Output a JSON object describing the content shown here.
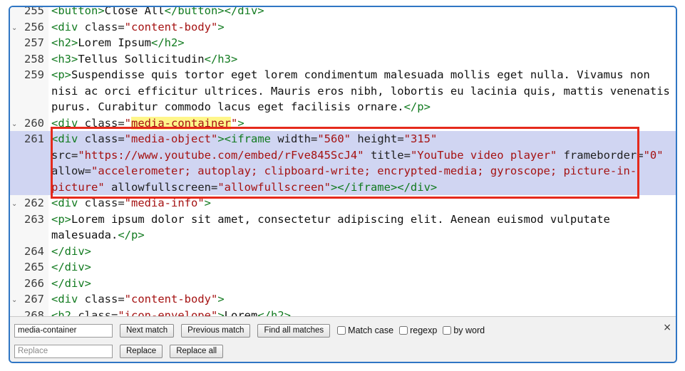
{
  "editor": {
    "lines": [
      {
        "num": "255",
        "fold": false,
        "segments": [
          {
            "c": "tag",
            "t": "<button>"
          },
          {
            "c": "text",
            "t": "Close All"
          },
          {
            "c": "tag",
            "t": "</button></div>"
          }
        ]
      },
      {
        "num": "256",
        "fold": true,
        "segments": [
          {
            "c": "tag",
            "t": "<div "
          },
          {
            "c": "attr",
            "t": "class="
          },
          {
            "c": "str",
            "t": "\"content-body\""
          },
          {
            "c": "tag",
            "t": ">"
          }
        ]
      },
      {
        "num": "257",
        "fold": false,
        "segments": [
          {
            "c": "tag",
            "t": "<h2>"
          },
          {
            "c": "text",
            "t": "Lorem Ipsum"
          },
          {
            "c": "tag",
            "t": "</h2>"
          }
        ]
      },
      {
        "num": "258",
        "fold": false,
        "segments": [
          {
            "c": "tag",
            "t": "<h3>"
          },
          {
            "c": "text",
            "t": "Tellus Sollicitudin"
          },
          {
            "c": "tag",
            "t": "</h3>"
          }
        ]
      },
      {
        "num": "259",
        "fold": false,
        "segments": [
          {
            "c": "tag",
            "t": "<p>"
          },
          {
            "c": "text",
            "t": "Suspendisse quis tortor eget lorem condimentum malesuada mollis eget nulla. Vivamus non nisi ac orci efficitur ultrices. Mauris eros nibh, lobortis eu lacinia quis, mattis venenatis purus. Curabitur commodo lacus eget facilisis ornare."
          },
          {
            "c": "tag",
            "t": "</p>"
          }
        ]
      },
      {
        "num": "260",
        "fold": true,
        "segments": [
          {
            "c": "tag",
            "t": "<div "
          },
          {
            "c": "attr",
            "t": "class="
          },
          {
            "c": "str",
            "t": "\""
          },
          {
            "c": "str hl",
            "t": "media-container"
          },
          {
            "c": "str",
            "t": "\""
          },
          {
            "c": "tag",
            "t": ">"
          }
        ]
      },
      {
        "num": "261",
        "fold": false,
        "current": true,
        "segments": [
          {
            "c": "tag",
            "t": "<div "
          },
          {
            "c": "attr",
            "t": "class="
          },
          {
            "c": "str",
            "t": "\"media-object\""
          },
          {
            "c": "tag",
            "t": "><iframe "
          },
          {
            "c": "attr",
            "t": "width="
          },
          {
            "c": "str",
            "t": "\"560\" "
          },
          {
            "c": "attr",
            "t": "height="
          },
          {
            "c": "str",
            "t": "\"315\" "
          },
          {
            "c": "attr",
            "t": "src="
          },
          {
            "c": "str",
            "t": "\"https://www.youtube.com/embed/rFve845ScJ4\" "
          },
          {
            "c": "attr",
            "t": "title="
          },
          {
            "c": "str",
            "t": "\"YouTube video player\" "
          },
          {
            "c": "attr",
            "t": "frameborder="
          },
          {
            "c": "str",
            "t": "\"0\" "
          },
          {
            "c": "attr",
            "t": "allow="
          },
          {
            "c": "str",
            "t": "\"accelerometer; autoplay; clipboard-write; encrypted-media; gyroscope; picture-in-picture\" "
          },
          {
            "c": "attr",
            "t": "allowfullscreen="
          },
          {
            "c": "str",
            "t": "\"allowfullscreen\""
          },
          {
            "c": "tag",
            "t": "></iframe></div>"
          }
        ]
      },
      {
        "num": "262",
        "fold": true,
        "segments": [
          {
            "c": "tag",
            "t": "<div "
          },
          {
            "c": "attr",
            "t": "class="
          },
          {
            "c": "str",
            "t": "\"media-info\""
          },
          {
            "c": "tag",
            "t": ">"
          }
        ]
      },
      {
        "num": "263",
        "fold": false,
        "segments": [
          {
            "c": "tag",
            "t": "<p>"
          },
          {
            "c": "text",
            "t": "Lorem ipsum dolor sit amet, consectetur adipiscing elit. Aenean euismod vulputate malesuada."
          },
          {
            "c": "tag",
            "t": "</p>"
          }
        ]
      },
      {
        "num": "264",
        "fold": false,
        "segments": [
          {
            "c": "tag",
            "t": "</div>"
          }
        ]
      },
      {
        "num": "265",
        "fold": false,
        "segments": [
          {
            "c": "tag",
            "t": "</div>"
          }
        ]
      },
      {
        "num": "266",
        "fold": false,
        "segments": [
          {
            "c": "tag",
            "t": "</div>"
          }
        ]
      },
      {
        "num": "267",
        "fold": true,
        "segments": [
          {
            "c": "tag",
            "t": "<div "
          },
          {
            "c": "attr",
            "t": "class="
          },
          {
            "c": "str",
            "t": "\"content-body\""
          },
          {
            "c": "tag",
            "t": ">"
          }
        ]
      },
      {
        "num": "268",
        "fold": true,
        "segments": [
          {
            "c": "tag",
            "t": "<h2 "
          },
          {
            "c": "attr",
            "t": "class="
          },
          {
            "c": "str",
            "t": "\"icon-envelope\""
          },
          {
            "c": "tag",
            "t": ">"
          },
          {
            "c": "text",
            "t": "Lorem"
          },
          {
            "c": "tag",
            "t": "</h2>"
          }
        ]
      }
    ]
  },
  "search": {
    "find_value": "media-container",
    "replace_placeholder": "Replace",
    "next_label": "Next match",
    "previous_label": "Previous match",
    "find_all_label": "Find all matches",
    "match_case_label": "Match case",
    "regexp_label": "regexp",
    "by_word_label": "by word",
    "replace_label": "Replace",
    "replace_all_label": "Replace all",
    "close_glyph": "×"
  },
  "colors": {
    "tag": "#117a1f",
    "string": "#a51212",
    "highlight": "#fff68a",
    "current_line": "#d0d5f2",
    "annotation_box": "#e52a1c",
    "frame_border": "#2f76c4"
  },
  "icons": {
    "fold": "chevron-down-icon",
    "close": "close-icon"
  }
}
